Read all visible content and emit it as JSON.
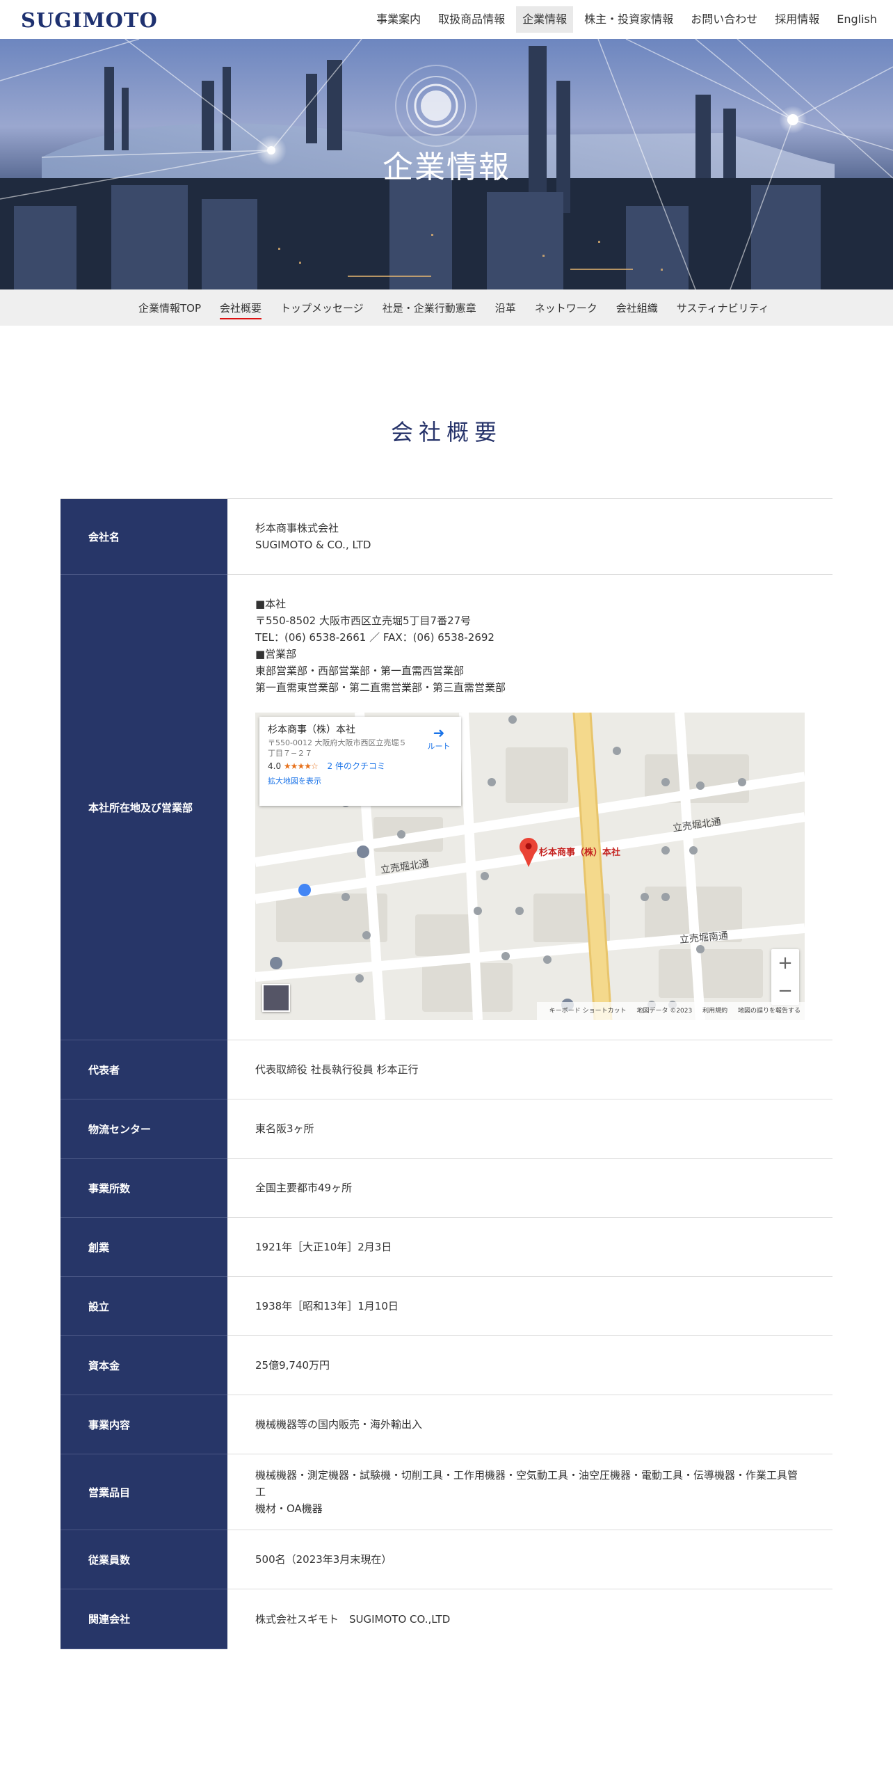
{
  "header": {
    "logo": "SUGIMOTO",
    "nav": [
      {
        "label": "事業案内"
      },
      {
        "label": "取扱商品情報"
      },
      {
        "label": "企業情報",
        "active": true
      },
      {
        "label": "株主・投資家情報"
      },
      {
        "label": "お問い合わせ"
      },
      {
        "label": "採用情報"
      },
      {
        "label": "English"
      }
    ]
  },
  "hero": {
    "title": "企業情報"
  },
  "subnav": [
    {
      "label": "企業情報TOP"
    },
    {
      "label": "会社概要",
      "active": true
    },
    {
      "label": "トップメッセージ"
    },
    {
      "label": "社是・企業行動憲章"
    },
    {
      "label": "沿革"
    },
    {
      "label": "ネットワーク"
    },
    {
      "label": "会社組織"
    },
    {
      "label": "サスティナビリティ"
    }
  ],
  "section_title": "会社概要",
  "rows": [
    {
      "label": "会社名",
      "lines": [
        "杉本商事株式会社",
        "SUGIMOTO & CO., LTD"
      ]
    },
    {
      "label": "本社所在地及び営業部",
      "lines": [
        "■本社",
        "〒550-8502 大阪市西区立売堀5丁目7番27号",
        "TEL：(06) 6538-2661 ／ FAX：(06) 6538-2692",
        "■営業部",
        "東部営業部・西部営業部・第一直需西営業部",
        "第一直需東営業部・第二直需営業部・第三直需営業部"
      ]
    },
    {
      "label": "代表者",
      "lines": [
        "代表取締役 社長執行役員 杉本正行"
      ]
    },
    {
      "label": "物流センター",
      "lines": [
        "東名阪3ヶ所"
      ]
    },
    {
      "label": "事業所数",
      "lines": [
        "全国主要都市49ヶ所"
      ]
    },
    {
      "label": "創業",
      "lines": [
        "1921年［大正10年］2月3日"
      ]
    },
    {
      "label": "設立",
      "lines": [
        "1938年［昭和13年］1月10日"
      ]
    },
    {
      "label": "資本金",
      "lines": [
        "25億9,740万円"
      ]
    },
    {
      "label": "事業内容",
      "lines": [
        "機械機器等の国内販売・海外輸出入"
      ]
    },
    {
      "label": "営業品目",
      "lines": [
        "機械機器・測定機器・試験機・切削工具・工作用機器・空気動工具・油空圧機器・電動工具・伝導機器・作業工具管工",
        "機材・OA機器"
      ]
    },
    {
      "label": "従業員数",
      "lines": [
        "500名（2023年3月末現在）"
      ]
    },
    {
      "label": "関連会社",
      "lines": [
        "株式会社スギモト　SUGIMOTO CO.,LTD"
      ]
    }
  ],
  "map": {
    "place_name": "杉本商事（株）本社",
    "place_address": "〒550-0012 大阪府大阪市西区立売堀５丁目７−２７",
    "rating": "4.0",
    "stars": "★★★★☆",
    "reviews": "2 件のクチコミ",
    "larger_map": "拡大地図を表示",
    "route": "ルート",
    "route_icon": "directions-icon",
    "pin_label": "杉本商事（株）本社",
    "streets": [
      "立売堀北通",
      "立売堀北通",
      "立売堀南通"
    ],
    "zoom_in": "+",
    "zoom_out": "−",
    "footer": [
      "キーボード ショートカット",
      "地図データ ©2023",
      "利用規約",
      "地図の誤りを報告する"
    ]
  }
}
